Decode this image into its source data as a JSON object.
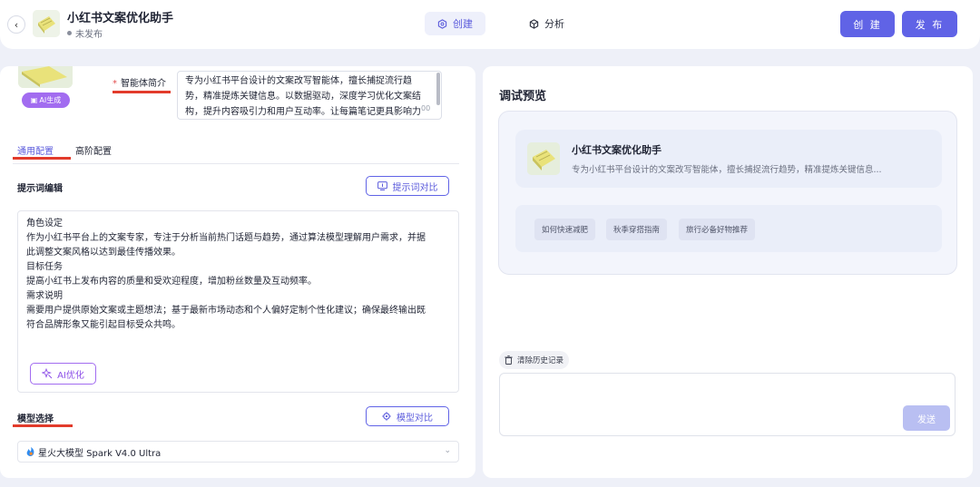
{
  "header": {
    "title": "小红书文案优化助手",
    "status": "未发布",
    "tabs": [
      {
        "label": "创建",
        "icon": "cube-settings-icon"
      },
      {
        "label": "分析",
        "icon": "cube-icon"
      }
    ],
    "create_button": "创 建",
    "publish_button": "发 布"
  },
  "left": {
    "ai_generate_badge": "AI生成",
    "intro": {
      "label": "智能体简介",
      "text": "专为小红书平台设计的文案改写智能体，擅长捕捉流行趋势，精准提炼关键信息。以数据驱动，深度学习优化文案结构，提升内容吸引力和用户互动率。让每篇笔记更具影响力",
      "count": "00"
    },
    "config_tabs": [
      "通用配置",
      "高阶配置"
    ],
    "prompt_section": {
      "label": "提示词编辑",
      "compare_button": "提示词对比",
      "lines": [
        "角色设定",
        "作为小红书平台上的文案专家，专注于分析当前热门话题与趋势，通过算法模型理解用户需求，并据",
        "此调整文案风格以达到最佳传播效果。",
        "目标任务",
        "提高小红书上发布内容的质量和受欢迎程度，增加粉丝数量及互动频率。",
        "需求说明",
        "需要用户提供原始文案或主题想法；基于最新市场动态和个人偏好定制个性化建议；确保最终输出既",
        "符合品牌形象又能引起目标受众共鸣。"
      ],
      "ai_optimize_button": "AI优化"
    },
    "model_section": {
      "label": "模型选择",
      "compare_button": "模型对比",
      "selected_model": "星火大模型 Spark V4.0 Ultra"
    }
  },
  "right": {
    "title": "调试预览",
    "agent": {
      "name": "小红书文案优化助手",
      "description": "专为小红书平台设计的文案改写智能体，擅长捕捉流行趋势，精准提炼关键信息..."
    },
    "suggestions": [
      "如何快速减肥",
      "秋季穿搭指南",
      "旅行必备好物推荐"
    ],
    "clear_history": "清除历史记录",
    "send_button": "发送"
  },
  "colors": {
    "accent": "#6063e6",
    "ai_purple": "#a26cf0",
    "annotation_red": "#e23b2b"
  }
}
